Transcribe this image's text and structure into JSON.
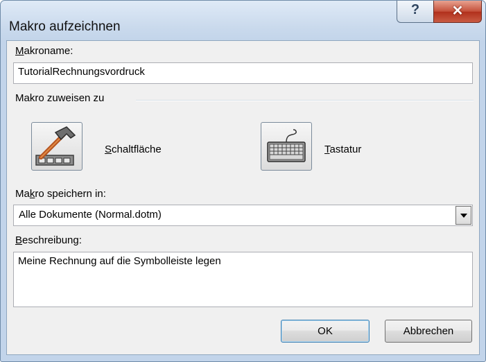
{
  "dialog": {
    "title": "Makro aufzeichnen",
    "help_glyph": "?",
    "close_glyph": "✕"
  },
  "macro_name": {
    "label_hotkey": "M",
    "label_rest": "akroname:",
    "value": "TutorialRechnungsvordruck"
  },
  "assign": {
    "group_label": "Makro zuweisen zu",
    "button_hotkey": "S",
    "button_rest": "chaltfläche",
    "keyboard_hotkey": "T",
    "keyboard_rest": "astatur"
  },
  "store_in": {
    "label_pre": "Ma",
    "label_hotkey": "k",
    "label_post": "ro speichern in:",
    "selected": "Alle Dokumente (Normal.dotm)"
  },
  "description": {
    "label_hotkey": "B",
    "label_rest": "eschreibung:",
    "value": "Meine Rechnung auf die Symbolleiste legen"
  },
  "buttons": {
    "ok": "OK",
    "cancel": "Abbrechen"
  },
  "icons": {
    "button_icon": "hammer-toolbar-icon",
    "keyboard_icon": "keyboard-icon"
  }
}
